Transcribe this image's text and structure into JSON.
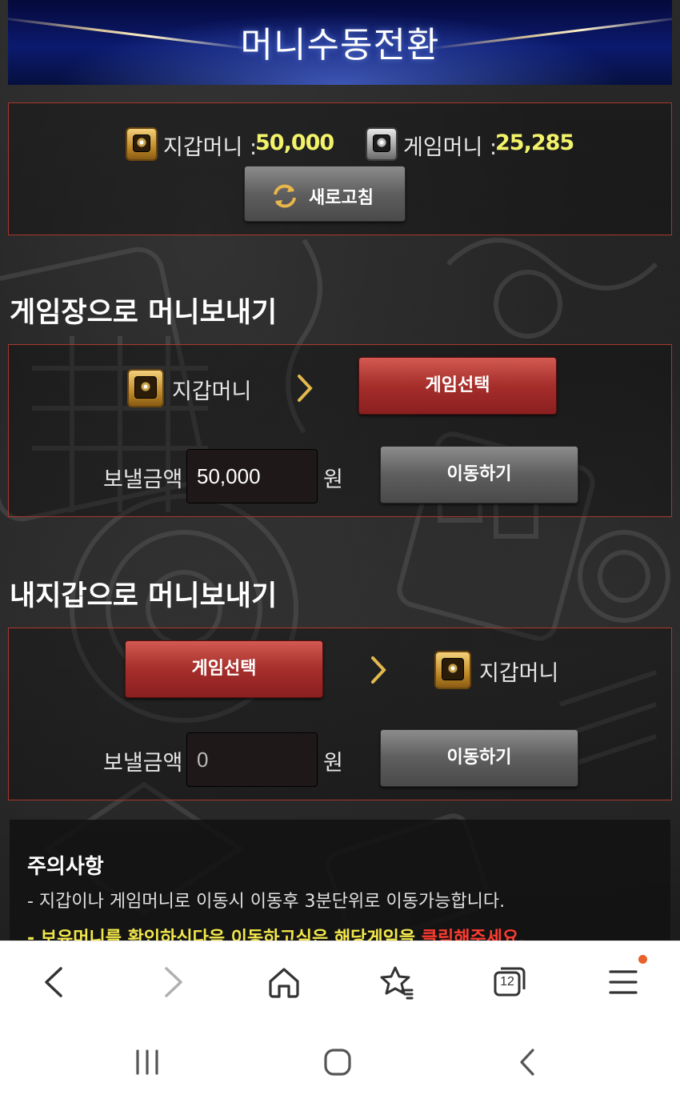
{
  "header": {
    "title": "머니수동전환"
  },
  "balance": {
    "wallet_label": "지갑머니 :",
    "wallet_amount": "50,000",
    "game_label": "게임머니 :",
    "game_amount": "25,285",
    "refresh_label": "새로고침"
  },
  "to_game": {
    "title": "게임장으로 머니보내기",
    "source_label": "지갑머니",
    "select_game_label": "게임선택",
    "send_label": "보낼금액",
    "amount_value": "50,000",
    "unit": "원",
    "move_label": "이동하기"
  },
  "to_wallet": {
    "title": "내지갑으로 머니보내기",
    "select_game_label": "게임선택",
    "target_label": "지갑머니",
    "send_label": "보낼금액",
    "amount_value": "0",
    "unit": "원",
    "move_label": "이동하기"
  },
  "notice": {
    "title": "주의사항",
    "line1": "- 지갑이나 게임머니로 이동시 이동후 3분단위로 이동가능합니다.",
    "line2_prefix": "- 보유머니를 확인하신다음 이동하고싶은 해당게임을 ",
    "line2_highlight": "클릭해주세요."
  },
  "browser_toolbar": {
    "icons": [
      "back-icon",
      "forward-icon",
      "home-icon",
      "bookmarks-icon",
      "tabs-icon",
      "menu-icon"
    ],
    "tab_count": "12"
  },
  "android_nav": {
    "icons": [
      "recents-icon",
      "home-icon",
      "back-icon"
    ]
  },
  "colors": {
    "accent_red": "#a62e2b",
    "border_red": "#a8382e",
    "balance_yellow": "#f3f36a",
    "notice_yellow": "#f3e84b",
    "notice_red": "#ff3b30",
    "banner_blue": "#0b1a6e"
  }
}
